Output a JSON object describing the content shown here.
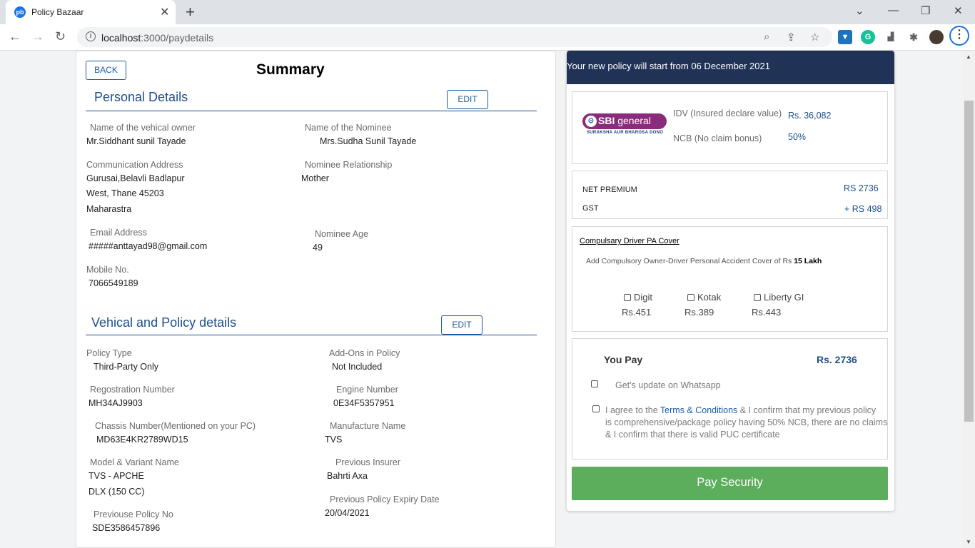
{
  "browser": {
    "tab_title": "Policy Bazaar",
    "favicon_text": "pb",
    "url_host": "localhost",
    "url_rest": ":3000/paydetails"
  },
  "summary": {
    "back_label": "BACK",
    "title": "Summary",
    "edit_label": "EDIT",
    "personal": {
      "heading": "Personal Details",
      "owner_label": "Name of the vehical owner",
      "owner_value": "Mr.Siddhant sunil Tayade",
      "nominee_label": "Name of the Nominee",
      "nominee_value": "Mrs.Sudha Sunil Tayade",
      "address_label": "Communication Address",
      "address_line1": "Gurusai,Belavli Badlapur",
      "address_line2": "West, Thane 45203",
      "address_line3": "Maharastra",
      "relationship_label": "Nominee Relationship",
      "relationship_value": "Mother",
      "email_label": "Email Address",
      "email_value": "#####anttayad98@gmail.com",
      "nominee_age_label": "Nominee Age",
      "nominee_age_value": "49",
      "mobile_label": "Mobile No.",
      "mobile_value": "7066549189"
    },
    "vehicle": {
      "heading": "Vehical and Policy details",
      "policy_type_label": "Policy Type",
      "policy_type_value": "Third-Party Only",
      "addons_label": "Add-Ons in Policy",
      "addons_value": "Not Included",
      "reg_label": "Regostration Number",
      "reg_value": "MH34AJ9903",
      "engine_label": "Engine Number",
      "engine_value": "0E34F5357951",
      "chassis_label": "Chassis Number(Mentioned on your PC)",
      "chassis_value": "MD63E4KR2789WD15",
      "manufacture_label": "Manufacture Name",
      "manufacture_value": "TVS",
      "model_label": "Model & Variant Name",
      "model_value_line1": "TVS - APCHE",
      "model_value_line2": "DLX (150 CC)",
      "prev_insurer_label": "Previous Insurer",
      "prev_insurer_value": "Bahrti Axa",
      "prev_expiry_label": "Previous Policy Expiry Date",
      "prev_expiry_value": "20/04/2021",
      "prev_policy_label": "Previouse Policy No",
      "prev_policy_value": "SDE3586457896"
    }
  },
  "right": {
    "banner": "Your new policy will start from 06 December 2021",
    "insurer": {
      "logo_text": "SBI",
      "logo_text2": "general",
      "logo_tag": "SURAKSHA AUR BHAROSA DONO",
      "idv_label": "IDV (Insured declare value)",
      "idv_value": "Rs. 36,082",
      "ncb_label": "NCB (No claim bonus)",
      "ncb_value": "50%"
    },
    "premium": {
      "net_label": "NET PREMIUM",
      "net_value": "RS 2736",
      "gst_label": "GST",
      "gst_value": "+ RS 498"
    },
    "pa_cover": {
      "title": "Compulsary Driver PA Cover",
      "desc": "Add Compulsory Owner-Driver Personal Accident Cover of Rs",
      "amount": "15 Lakh",
      "options": [
        {
          "name": "Digit",
          "price": "Rs.451"
        },
        {
          "name": "Kotak",
          "price": "Rs.389"
        },
        {
          "name": "Liberty GI",
          "price": "Rs.443"
        }
      ]
    },
    "pay": {
      "you_pay_label": "You Pay",
      "you_pay_value": "Rs. 2736",
      "whatsapp_label": "Get's update on Whatsapp",
      "agree_prefix": "I agree to the",
      "terms_link": "Terms & Conditions",
      "agree_rest1": "& I confirm that my previous policy",
      "agree_line2": "is comprehensive/package policy having 50% NCB, there are no claims",
      "agree_line3": "& I confirm that there is valid PUC certificate",
      "button_label": "Pay Security"
    }
  }
}
